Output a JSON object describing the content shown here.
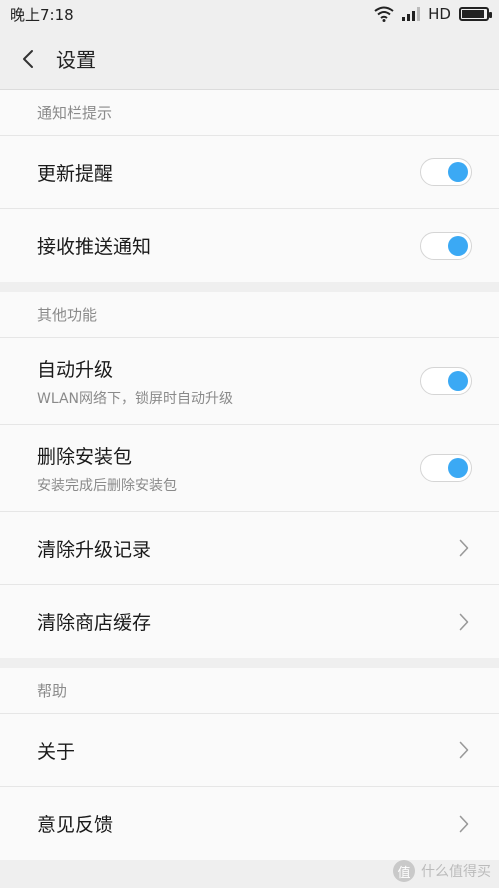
{
  "status": {
    "time": "晚上7:18",
    "network": "HD"
  },
  "header": {
    "title": "设置"
  },
  "sections": [
    {
      "header": "通知栏提示",
      "items": [
        {
          "title": "更新提醒",
          "toggle_on": true
        },
        {
          "title": "接收推送通知",
          "toggle_on": true
        }
      ]
    },
    {
      "header": "其他功能",
      "items": [
        {
          "title": "自动升级",
          "subtitle": "WLAN网络下，锁屏时自动升级",
          "toggle_on": true
        },
        {
          "title": "删除安装包",
          "subtitle": "安装完成后删除安装包",
          "toggle_on": true
        },
        {
          "title": "清除升级记录"
        },
        {
          "title": "清除商店缓存"
        }
      ]
    },
    {
      "header": "帮助",
      "items": [
        {
          "title": "关于"
        },
        {
          "title": "意见反馈"
        }
      ]
    }
  ],
  "watermark": {
    "badge": "值",
    "text": "什么值得买"
  },
  "colors": {
    "accent": "#3ba9f4",
    "background": "#efefef",
    "card": "#fafafa"
  }
}
